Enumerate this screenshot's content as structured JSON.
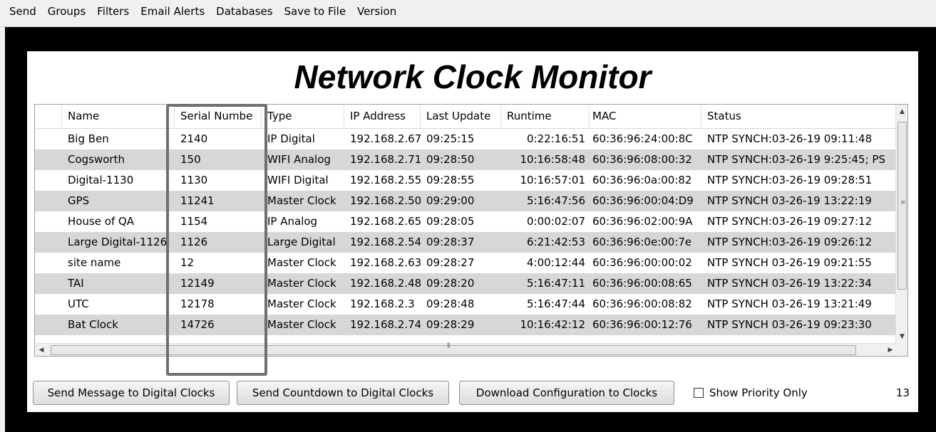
{
  "menu": [
    "Send",
    "Groups",
    "Filters",
    "Email Alerts",
    "Databases",
    "Save to File",
    "Version"
  ],
  "title": "Network Clock Monitor",
  "table": {
    "columns": [
      "",
      "Name",
      "Serial Numbe",
      "Type",
      "IP Address",
      "Last Update",
      "Runtime",
      "MAC",
      "Status"
    ],
    "rows": [
      [
        "Big Ben",
        "2140",
        "IP Digital",
        "192.168.2.67",
        "09:25:15",
        "0:22:16:51",
        "60:36:96:24:00:8C",
        "NTP SYNCH:03-26-19 09:11:48"
      ],
      [
        "Cogsworth",
        "150",
        "WIFI Analog",
        "192.168.2.71",
        "09:28:50",
        "10:16:58:48",
        "60:36:96:08:00:32",
        "NTP SYNCH:03-26-19 9:25:45; PS"
      ],
      [
        "Digital-1130",
        "1130",
        "WIFI Digital",
        "192.168.2.55",
        "09:28:55",
        "10:16:57:01",
        "60:36:96:0a:00:82",
        "NTP SYNCH:03-26-19 09:28:51"
      ],
      [
        "GPS",
        "11241",
        "Master Clock",
        "192.168.2.50",
        "09:29:00",
        "5:16:47:56",
        "60:36:96:00:04:D9",
        "NTP SYNCH 03-26-19  13:22:19"
      ],
      [
        "House of QA",
        "1154",
        "IP Analog",
        "192.168.2.65",
        "09:28:05",
        "0:00:02:07",
        "60:36:96:02:00:9A",
        "NTP SYNCH:03-26-19 09:27:12"
      ],
      [
        "Large Digital-1126",
        "1126",
        "Large Digital",
        "192.168.2.54",
        "09:28:37",
        "6:21:42:53",
        "60:36:96:0e:00:7e",
        "NTP SYNCH:03-26-19 09:26:12"
      ],
      [
        "site name",
        "12",
        "Master Clock",
        "192.168.2.63",
        "09:28:27",
        "4:00:12:44",
        "60:36:96:00:00:02",
        "NTP SYNCH 03-26-19  09:21:55"
      ],
      [
        "TAI",
        "12149",
        "Master Clock",
        "192.168.2.48",
        "09:28:20",
        "5:16:47:11",
        "60:36:96:00:08:65",
        "NTP SYNCH 03-26-19  13:22:34"
      ],
      [
        "UTC",
        "12178",
        "Master Clock",
        "192.168.2.3",
        "09:28:48",
        "5:16:47:44",
        "60:36:96:00:08:82",
        "NTP SYNCH 03-26-19  13:21:49"
      ],
      [
        "Bat Clock",
        "14726",
        "Master Clock",
        "192.168.2.74",
        "09:28:29",
        "10:16:42:12",
        "60:36:96:00:12:76",
        "NTP SYNCH 03-26-19  09:23:30"
      ]
    ]
  },
  "buttons": {
    "send_message": "Send Message to Digital Clocks",
    "send_countdown": "Send Countdown to Digital Clocks",
    "download_config": "Download Configuration to Clocks"
  },
  "show_priority_label": "Show Priority Only",
  "show_priority_checked": false,
  "clock_count": "13",
  "icons": {
    "scroll_up": "scroll-up-arrow-icon",
    "scroll_down": "scroll-down-arrow-icon",
    "scroll_left": "scroll-left-arrow-icon",
    "scroll_right": "scroll-right-arrow-icon"
  },
  "colors": {
    "background": "#000000",
    "panel": "#ffffff",
    "alt_row": "#d7d7d7",
    "highlight_box": "#6f6f6f"
  }
}
